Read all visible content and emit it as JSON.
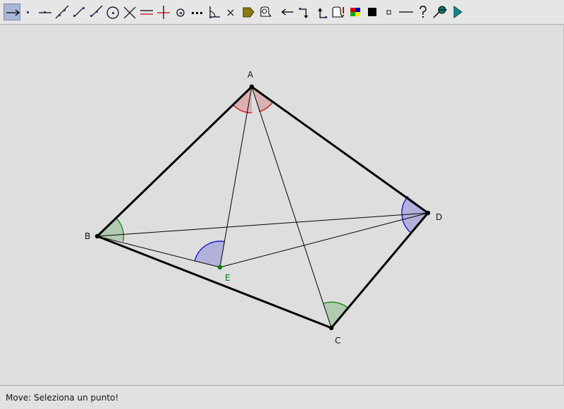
{
  "toolbar": {
    "tools": [
      {
        "icon": "move-arrow-icon",
        "active": true
      },
      {
        "icon": "point-icon"
      },
      {
        "icon": "point-on-line-icon"
      },
      {
        "icon": "line-icon"
      },
      {
        "icon": "segment-icon"
      },
      {
        "icon": "ray-icon"
      },
      {
        "icon": "circle-icon"
      },
      {
        "icon": "intersection-icon"
      },
      {
        "icon": "parallel-icon"
      },
      {
        "icon": "perpendicular-icon"
      },
      {
        "icon": "midpoint-icon"
      },
      {
        "icon": "dotted-line-icon"
      },
      {
        "icon": "angle-icon"
      },
      {
        "icon": "delete-icon"
      },
      {
        "icon": "label-tag-icon"
      },
      {
        "icon": "hide-icon"
      },
      {
        "icon": "undo-arrow-icon"
      },
      {
        "icon": "step-forward-icon"
      },
      {
        "icon": "step-back-icon"
      },
      {
        "icon": "alert-icon"
      },
      {
        "icon": "color-palette-icon"
      },
      {
        "icon": "fill-square-icon"
      },
      {
        "icon": "small-point-icon"
      },
      {
        "icon": "line-style-icon"
      },
      {
        "icon": "help-icon"
      },
      {
        "icon": "zoom-tool-icon"
      },
      {
        "icon": "play-icon"
      }
    ]
  },
  "drawing": {
    "colors": {
      "segment": "#000000",
      "red_angle": "#cc0000",
      "green_angle": "#008000",
      "blue_angle": "#0000cc",
      "point_e": "#008000"
    },
    "points": {
      "A": {
        "label": "A"
      },
      "B": {
        "label": "B"
      },
      "C": {
        "label": "C"
      },
      "D": {
        "label": "D"
      },
      "E": {
        "label": "E"
      }
    }
  },
  "status": {
    "message": "Move: Seleziona un punto!"
  }
}
